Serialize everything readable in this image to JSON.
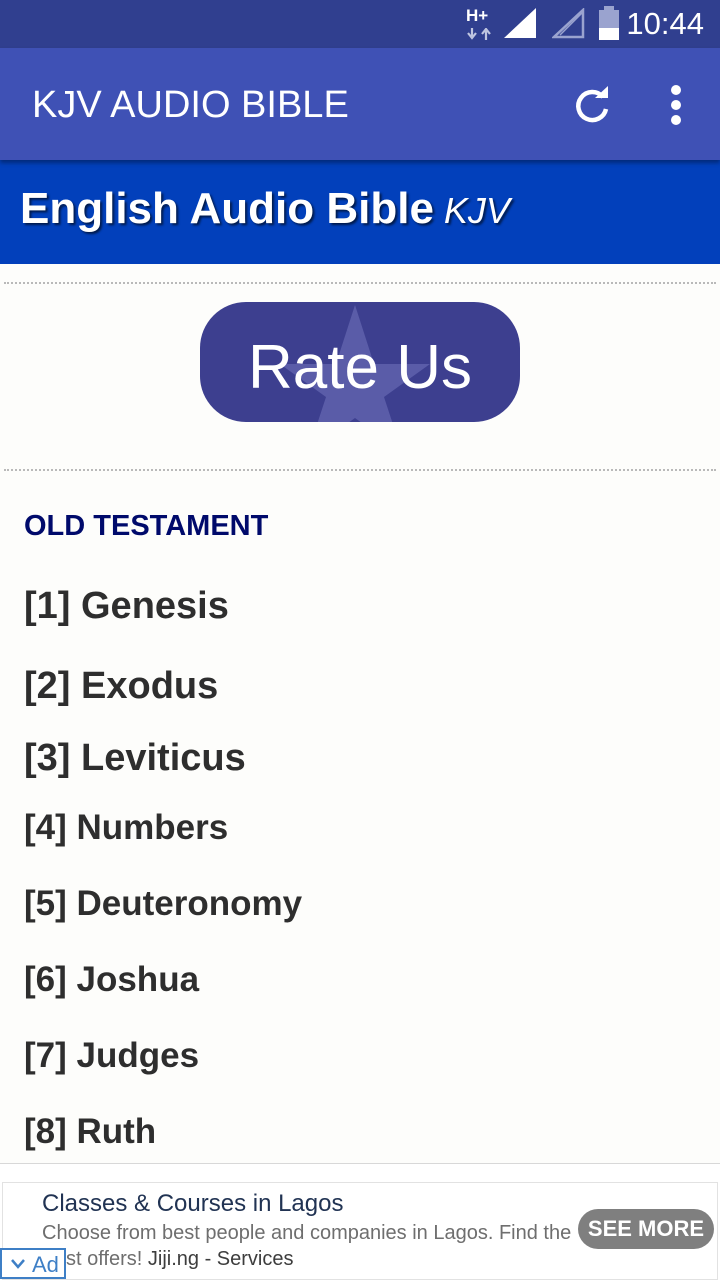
{
  "status_bar": {
    "network": "H+",
    "time": "10:44"
  },
  "app_bar": {
    "title": "KJV AUDIO BIBLE",
    "refresh_icon": "refresh-icon",
    "more_icon": "more-vert-icon"
  },
  "banner": {
    "title": "English Audio Bible",
    "subtitle": "KJV"
  },
  "rate_button": {
    "label": "Rate Us"
  },
  "section": {
    "title": "OLD TESTAMENT"
  },
  "books": [
    {
      "label": "[1] Genesis"
    },
    {
      "label": "[2] Exodus"
    },
    {
      "label": "[3] Leviticus"
    },
    {
      "label": "[4] Numbers"
    },
    {
      "label": "[5] Deuteronomy"
    },
    {
      "label": "[6] Joshua"
    },
    {
      "label": "[7] Judges"
    },
    {
      "label": "[8] Ruth"
    }
  ],
  "ad": {
    "title": "Classes & Courses in Lagos",
    "body_text": "Choose from best people and companies in Lagos. Find the",
    "body_text_2": "st offers!",
    "body_dark": "Jiji.ng - Services",
    "cta_label": "SEE MORE",
    "badge_label": "Ad"
  }
}
